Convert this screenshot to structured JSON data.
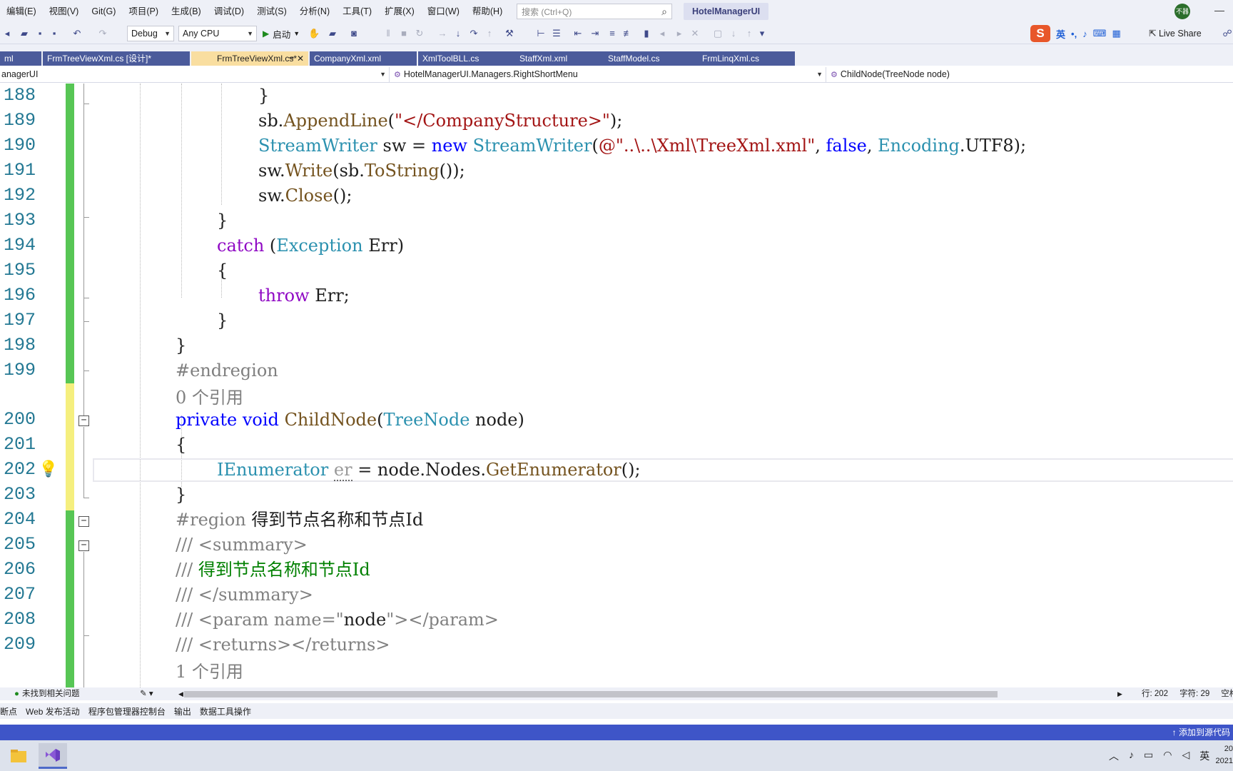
{
  "menubar": {
    "items": [
      "编辑(E)",
      "视图(V)",
      "Git(G)",
      "项目(P)",
      "生成(B)",
      "调试(D)",
      "测试(S)",
      "分析(N)",
      "工具(T)",
      "扩展(X)",
      "窗口(W)",
      "帮助(H)"
    ],
    "search_placeholder": "搜索 (Ctrl+Q)",
    "solution_name": "HotelManagerUI",
    "avatar_text": "不器",
    "minimize": "—"
  },
  "toolbar": {
    "config": "Debug",
    "platform": "Any CPU",
    "start_label": "启动",
    "ime_mode": "英",
    "live_share": "Live Share"
  },
  "tabs": [
    {
      "label": "ml",
      "active": false
    },
    {
      "label": "FrmTreeViewXml.cs [设计]*",
      "active": false
    },
    {
      "label": "FrmTreeViewXml.cs*",
      "active": true
    },
    {
      "label": "CompanyXml.xml",
      "active": false
    },
    {
      "label": "XmlToolBLL.cs",
      "active": false
    },
    {
      "label": "StaffXml.xml",
      "active": false
    },
    {
      "label": "StaffModel.cs",
      "active": false
    },
    {
      "label": "FrmLinqXml.cs",
      "active": false
    }
  ],
  "navbar": {
    "project": "anagerUI",
    "type": "HotelManagerUI.Managers.RightShortMenu",
    "member": "ChildNode(TreeNode node)"
  },
  "code": {
    "line_numbers": [
      "188",
      "189",
      "190",
      "191",
      "192",
      "193",
      "194",
      "195",
      "196",
      "197",
      "198",
      "199",
      "200",
      "201",
      "202",
      "203",
      "204",
      "205",
      "206",
      "207",
      "208",
      "209"
    ],
    "codelens": [
      "0 个引用",
      "1 个引用"
    ],
    "t188": "}",
    "t189_a": "sb.",
    "t189_b": "AppendLine",
    "t189_c": "(",
    "t189_d": "\"</CompanyStructure>\"",
    "t189_e": ");",
    "t190_a": "StreamWriter",
    "t190_b": " sw = ",
    "t190_c": "new",
    "t190_d": " ",
    "t190_e": "StreamWriter",
    "t190_f": "(",
    "t190_g": "@\"..\\..\\Xml\\TreeXml.xml\"",
    "t190_h": ", ",
    "t190_i": "false",
    "t190_j": ", ",
    "t190_k": "Encoding",
    "t190_l": ".UTF8);",
    "t191_a": "sw.",
    "t191_b": "Write",
    "t191_c": "(sb.",
    "t191_d": "ToString",
    "t191_e": "());",
    "t192_a": "sw.",
    "t192_b": "Close",
    "t192_c": "();",
    "t193": "}",
    "t194_a": "catch",
    "t194_b": " (",
    "t194_c": "Exception",
    "t194_d": " Err)",
    "t195": "{",
    "t196_a": "throw",
    "t196_b": " Err;",
    "t197": "}",
    "t198": "}",
    "t199": "#endregion",
    "t200_a": "private",
    "t200_b": " ",
    "t200_c": "void",
    "t200_d": " ",
    "t200_e": "ChildNode",
    "t200_f": "(",
    "t200_g": "TreeNode",
    "t200_h": " node)",
    "t201": "{",
    "t202_a": "IEnumerator",
    "t202_b": " ",
    "t202_c": "er",
    "t202_d": " = node.Nodes.",
    "t202_e": "GetEnumerator",
    "t202_f": "();",
    "t203": "}",
    "t204_a": "#region",
    "t204_b": " 得到节点名称和节点Id",
    "t205_a": "/// ",
    "t205_b": "<summary>",
    "t206_a": "/// ",
    "t206_b": "得到节点名称和节点Id",
    "t207_a": "/// ",
    "t207_b": "</summary>",
    "t208_a": "/// ",
    "t208_b": "<param name=\"",
    "t208_c": "node",
    "t208_d": "\"></param>",
    "t209_a": "/// ",
    "t209_b": "<returns></returns>"
  },
  "status": {
    "issues": "未找到相关问题",
    "row": "行: 202",
    "col": "字符: 29",
    "tail": "空格"
  },
  "panels": [
    "断点",
    "Web 发布活动",
    "程序包管理器控制台",
    "输出",
    "数据工具操作"
  ],
  "statusbar": {
    "source_control": "添加到源代码"
  },
  "taskbar": {
    "ime": "英",
    "time": "20",
    "date": "2021"
  }
}
